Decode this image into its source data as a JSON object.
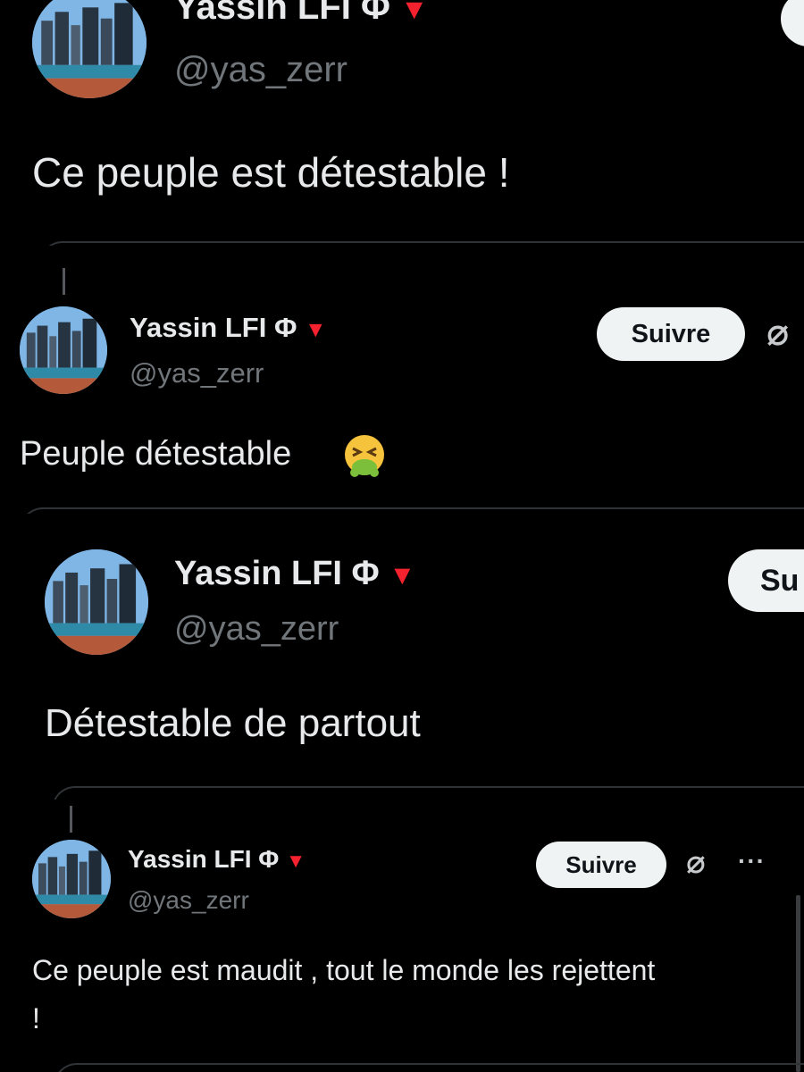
{
  "colors": {
    "background": "#000000",
    "text": "#e7e9ea",
    "handle": "#71767b",
    "verified_triangle": "#f4212e",
    "button_bg": "#eff3f4",
    "button_text": "#0f1419",
    "divider": "#2f3336"
  },
  "posts": [
    {
      "display_name": "Yassin LFI Φ",
      "badge_icon": "red-triangle-icon",
      "handle": "@yas_zerr",
      "text": "Ce peuple est détestable !",
      "follow_label": ""
    },
    {
      "display_name": "Yassin LFI Φ",
      "badge_icon": "red-triangle-icon",
      "handle": "@yas_zerr",
      "text": "Peuple détestable",
      "emoji": "face-vomiting-emoji",
      "follow_label": "Suivre",
      "grok_icon": "grok-icon"
    },
    {
      "display_name": "Yassin LFI Φ",
      "badge_icon": "red-triangle-icon",
      "handle": "@yas_zerr",
      "text": "Détestable de partout",
      "follow_label": "Su"
    },
    {
      "display_name": "Yassin LFI Φ",
      "badge_icon": "red-triangle-icon",
      "handle": "@yas_zerr",
      "text_line1": "Ce peuple est maudit , tout le monde les rejettent",
      "text_line2": "!",
      "follow_label": "Suivre",
      "grok_icon": "grok-icon",
      "more_icon": "more-options-icon"
    }
  ]
}
